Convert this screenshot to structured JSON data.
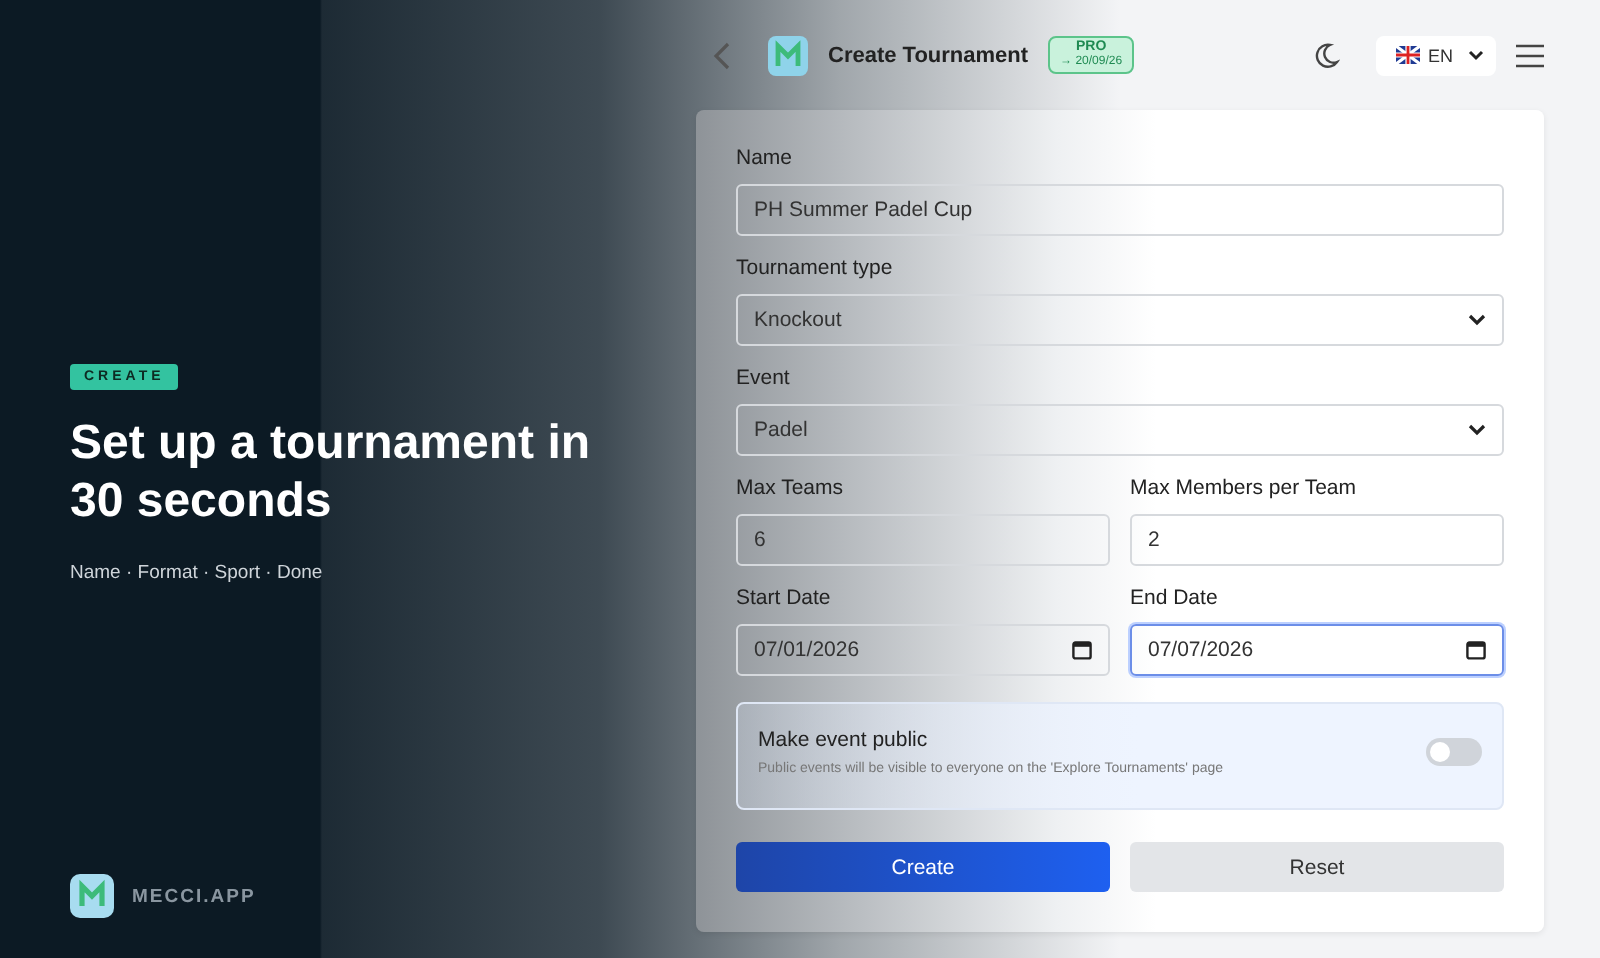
{
  "promo": {
    "tag": "CREATE",
    "headline": "Set up a tournament in 30 seconds",
    "steps": "Name · Format · Sport · Done",
    "brand": "MECCI.APP"
  },
  "header": {
    "title": "Create Tournament",
    "badge": {
      "label": "PRO",
      "expiry": "→ 20/09/26"
    },
    "language": "EN"
  },
  "form": {
    "rows": [
      [
        {
          "label": "Name",
          "kind": "text",
          "value": "PH Summer Padel Cup",
          "focused": false
        }
      ],
      [
        {
          "label": "Tournament type",
          "kind": "select",
          "value": "Knockout",
          "focused": false
        }
      ],
      [
        {
          "label": "Event",
          "kind": "select",
          "value": "Padel",
          "focused": false
        }
      ],
      [
        {
          "label": "Max Teams",
          "kind": "text",
          "value": "6",
          "focused": false
        },
        {
          "label": "Max Members per Team",
          "kind": "text",
          "value": "2",
          "focused": false
        }
      ],
      [
        {
          "label": "Start Date",
          "kind": "date",
          "value": "07/01/2026",
          "focused": false
        },
        {
          "label": "End Date",
          "kind": "date",
          "value": "07/07/2026",
          "focused": true
        }
      ]
    ],
    "public_toggle": {
      "title": "Make event public",
      "hint": "Public events will be visible to everyone on the 'Explore Tournaments' page",
      "on": false
    },
    "buttons": [
      {
        "label": "Create",
        "kind": "primary"
      },
      {
        "label": "Reset",
        "kind": "secondary"
      }
    ]
  }
}
